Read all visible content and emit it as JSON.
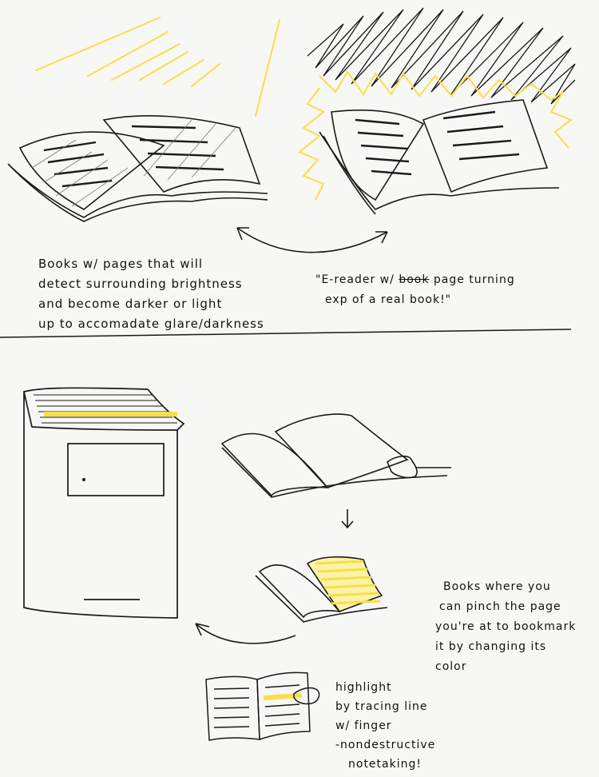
{
  "top_left_caption": {
    "lines": [
      "Books w/ pages that will",
      "detect surrounding brightness",
      "and become darker or light",
      "up to accomadate glare/darkness"
    ]
  },
  "top_right_caption": {
    "prefix": "\"E-reader w/",
    "struck_word": "book",
    "suffix": "page turning",
    "line2": "exp of a real book!\""
  },
  "bookmark_caption": {
    "lines": [
      "Books where you",
      "can pinch the page",
      "you're at to bookmark",
      "it by changing its",
      "color"
    ]
  },
  "highlight_caption": {
    "lines": [
      "highlight",
      "by tracing line",
      "w/ finger",
      "-nondestructive",
      "notetaking!"
    ]
  },
  "colors": {
    "ink": "#1a1a1a",
    "highlighter": "#f5e04a",
    "paper": "#f7f7f5"
  }
}
